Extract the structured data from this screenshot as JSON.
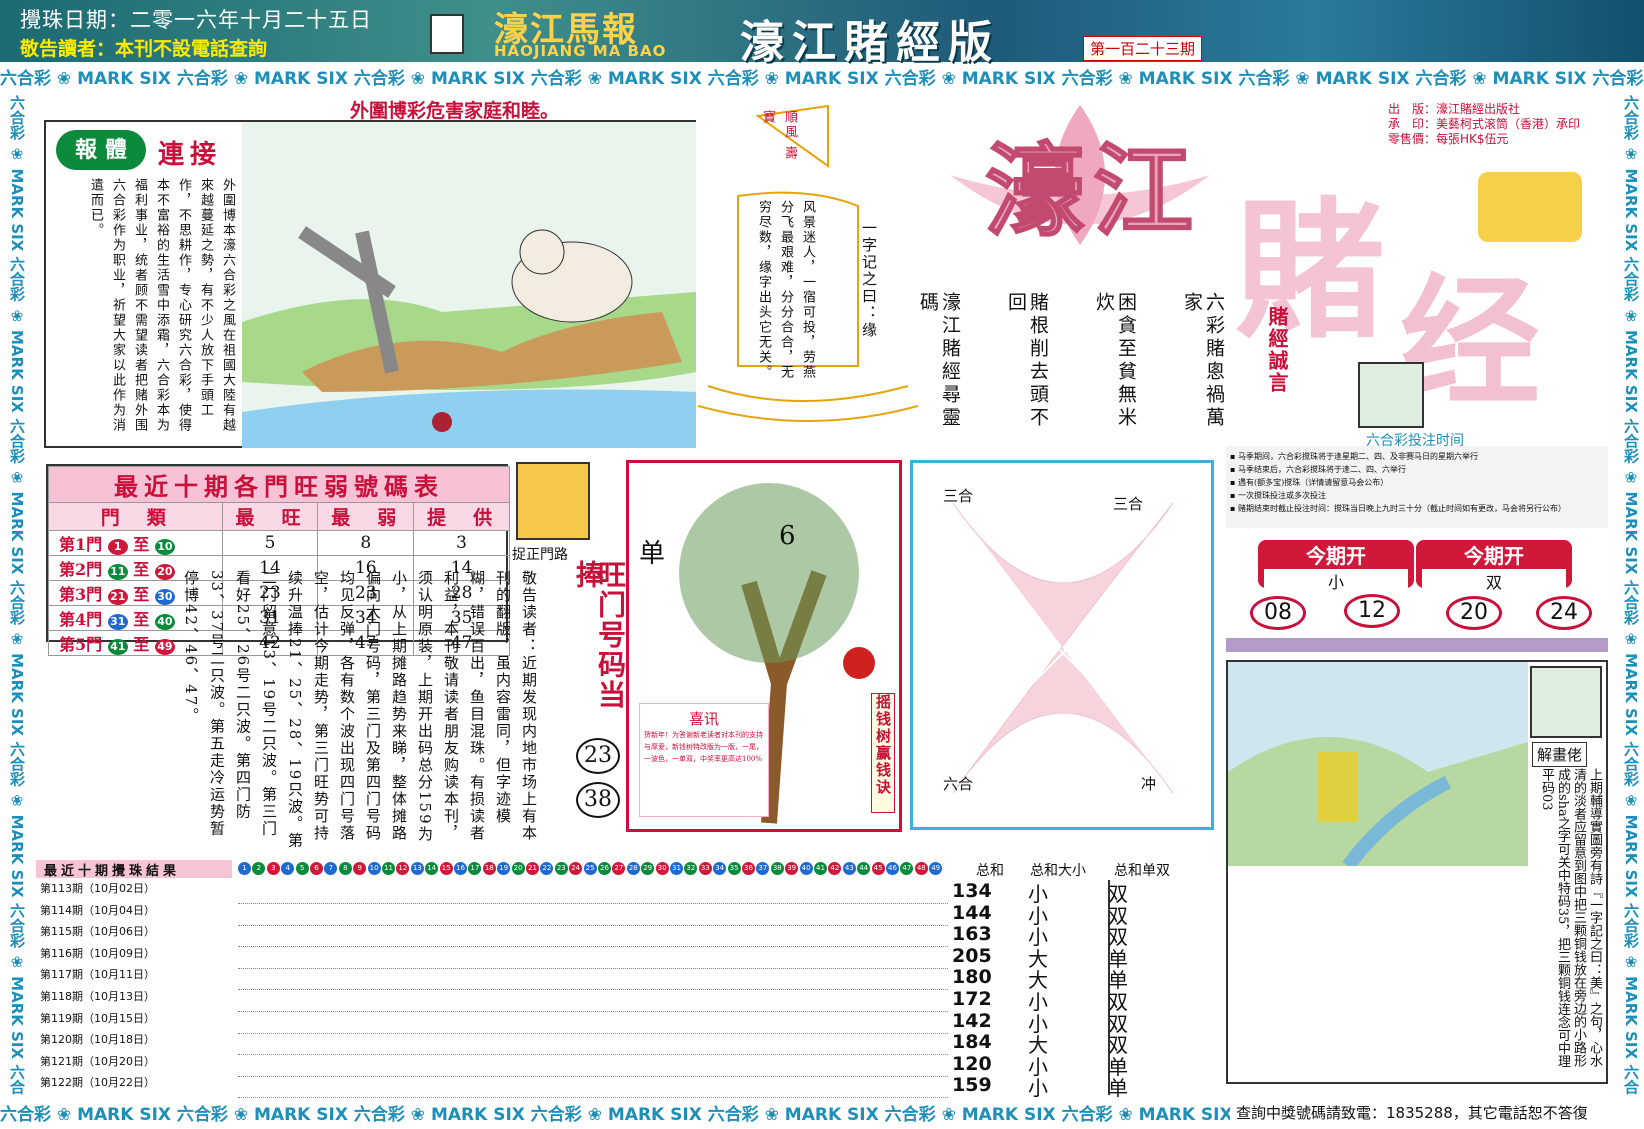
{
  "header": {
    "draw_date": "攪珠日期：二零一六年十月二十五日",
    "notice": "敬告讀者：本刊不設電話查詢",
    "masthead": "濠江馬報",
    "masthead_en": "HAOJIANG MA BAO",
    "edition": "濠江賭經版",
    "issue": "第一百二十三期"
  },
  "ribbon": {
    "unit": "六合彩 ❀ MARK SIX ",
    "bottom_right": "查詢中獎號碼請致電：1835288，其它電話恕不答復"
  },
  "warning": "外圍博彩危害家庭和睦。",
  "cartoon": {
    "tab_left": "報",
    "tab_mid": "體",
    "tab_right": "連接",
    "text": "外圍博本濠六合彩之風在祖國大陸有越來越蔓延之勢，有不少人放下手頭工作，不思耕作，专心研究六合彩，使得本不富裕的生活雪中添霜，六合彩本为福利事业，统者顾不需望读者把赌外围六合彩作为职业，祈望大家以此作为消遣而已。"
  },
  "sail": {
    "flag": "順風 壽寶",
    "poem": "风景迷人，一宿可投，劳燕分飞最艰难，分分合合，无穷尽数，缘字出头它无关。",
    "riddle": "一字记之曰：缘"
  },
  "brand": {
    "big1": "濠江",
    "big2": "賭",
    "big3": "经",
    "publisher": "出　版：濠江賭經出版社",
    "printer": "承　印：美藝柯式滚筒（香港）承印",
    "price": "零售價：每張HK$伍元",
    "motto": "賭經誠言",
    "poem_cols": [
      "六彩賭悤禍萬家",
      "困貪至貧無米炊",
      "賭根削去頭不回",
      "濠江賭經尋靈碼"
    ]
  },
  "ranking": {
    "title": "最近十期各門旺弱號碼表",
    "headers": [
      "門　類",
      "最　旺",
      "最　弱",
      "提　供"
    ],
    "rows": [
      {
        "door": "第1門",
        "from": "1",
        "to": "10",
        "hot": "5",
        "cold": "8",
        "tip": "3"
      },
      {
        "door": "第2門",
        "from": "11",
        "to": "20",
        "hot": "14",
        "cold": "16",
        "tip": "14"
      },
      {
        "door": "第3門",
        "from": "21",
        "to": "30",
        "hot": "23",
        "cold": "23",
        "tip": "28"
      },
      {
        "door": "第4門",
        "from": "31",
        "to": "40",
        "hot": "31",
        "cold": "34",
        "tip": "35"
      },
      {
        "door": "第5門",
        "from": "41",
        "to": "49",
        "hot": "42",
        "cold": "47",
        "tip": "47"
      }
    ],
    "to_word": "至"
  },
  "door_path": {
    "label": "捉正門路",
    "notice": "敬告读者：近期发现内地市场上有本刊的翻版，虽内容雷同，但字迹模糊，错误百出，鱼目混珠。有损读者利益，本刊敬请读者朋友购读本刊，须认明原装，上期开出码总分159为小，从上期摊路趋势来睇，整体摊路偏向大门号码，第三门及第四门号码均见反弹，各有数个波出现四门号落空，估计今期走势，第三门旺势可持续升温捧21、25、28、19只波。第二门留意13、19号二只波。第三门看好25、26号二只波。第四门防33、37号二只波。第五走冷运势暂停博42、46、47。",
    "hot_title": "旺门号码当捧",
    "hot_nums": [
      "23",
      "38"
    ]
  },
  "tree": {
    "left": "单",
    "right": "6",
    "side": "摇钱树赢钱诀",
    "news_title": "喜讯",
    "news_text": "贺新年！为答谢新老读者对本刊的支持与厚爱，新钱树特改版为一版，一尾，一波色，一单双，中奖率更高达100%"
  },
  "zodiac": {
    "tl": "三合",
    "tr": "三合",
    "bl": "六合",
    "br": "冲"
  },
  "bet_time": {
    "title": "六合彩投注时间",
    "items": [
      "马季期间，六合彩搅珠将于逢星期二、四、及非赛马日的星期六举行",
      "马季结束后，六合彩搅珠将于逢二、四、六举行",
      "遇有(额多宝)搅珠（详情请留意马会公布）",
      "一次搅珠投注或多次投注",
      "赌期结束时截止投注时间：搅珠当日晚上九时三十分（截止时间如有更改，马会将另行公布）"
    ]
  },
  "this_issue": {
    "label1": "今期开",
    "val1": "小",
    "label2": "今期开",
    "val2": "双",
    "nums": [
      "08",
      "12",
      "20",
      "24"
    ]
  },
  "painting": {
    "label": "解畫佬",
    "text": "上期輔導實圖旁有詩『一字記之曰：美』之句，心水清的淡者应留意到图中把三颗铜钱放在旁边的小路形成的sha之字可关中特码35，把三颗铜钱连念可中理平码03"
  },
  "results": {
    "title": "最近十期攪珠結果",
    "sum_header": "总和",
    "size_header": "总和大小",
    "oe_header": "总和单双",
    "rows": [
      {
        "label": "第113期（10月02日）",
        "sum": "134",
        "size": "小",
        "oe": "双"
      },
      {
        "label": "第114期（10月04日）",
        "sum": "144",
        "size": "小",
        "oe": "双"
      },
      {
        "label": "第115期（10月06日）",
        "sum": "163",
        "size": "小",
        "oe": "双"
      },
      {
        "label": "第116期（10月09日）",
        "sum": "205",
        "size": "大",
        "oe": "单"
      },
      {
        "label": "第117期（10月11日）",
        "sum": "180",
        "size": "大",
        "oe": "单"
      },
      {
        "label": "第118期（10月13日）",
        "sum": "172",
        "size": "小",
        "oe": "双"
      },
      {
        "label": "第119期（10月15日）",
        "sum": "142",
        "size": "小",
        "oe": "双"
      },
      {
        "label": "第120期（10月18日）",
        "sum": "184",
        "size": "大",
        "oe": "双"
      },
      {
        "label": "第121期（10月20日）",
        "sum": "120",
        "size": "小",
        "oe": "单"
      },
      {
        "label": "第122期（10月22日）",
        "sum": "159",
        "size": "小",
        "oe": "单"
      }
    ]
  },
  "colors": {
    "red": "#c8103a",
    "blue": "#1e8fb8",
    "green": "#0a8a3a",
    "pink": "#f7c1d6"
  }
}
